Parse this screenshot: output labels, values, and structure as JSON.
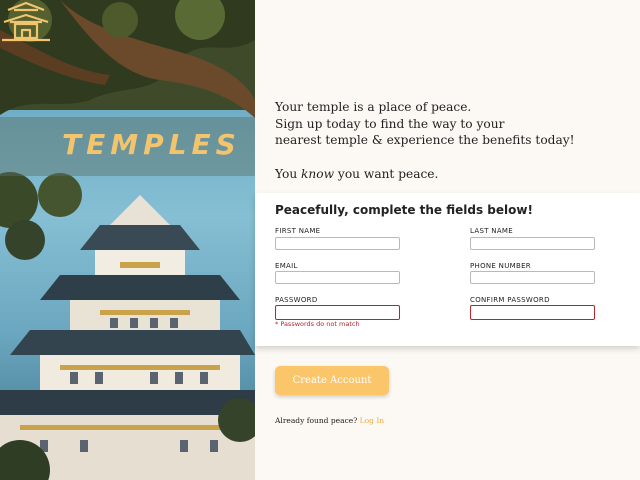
{
  "brand": {
    "name": "TEMPLES",
    "icon": "pagoda-icon",
    "color": "#f3c46e"
  },
  "intro": {
    "line1": "Your temple is a place of peace.",
    "line2": "Sign up today to find the way to your",
    "line3": "nearest temple & experience the benefits today!",
    "line4_pre": "You ",
    "line4_em": "know",
    "line4_post": " you want peace."
  },
  "form": {
    "title": "Peacefully, complete the fields below!",
    "fields": {
      "first_name": {
        "label": "FIRST NAME",
        "value": ""
      },
      "last_name": {
        "label": "LAST NAME",
        "value": ""
      },
      "email": {
        "label": "EMAIL",
        "value": ""
      },
      "phone": {
        "label": "PHONE NUMBER",
        "value": ""
      },
      "password": {
        "label": "PASSWORD",
        "value": ""
      },
      "confirm_password": {
        "label": "CONFIRM PASSWORD",
        "value": ""
      }
    },
    "error": "* Passwords do not match",
    "error_color": "#b3262f"
  },
  "actions": {
    "create_label": "Create Account",
    "button_color": "#fbc66a",
    "login_prompt": "Already found peace?",
    "login_link": "Log In",
    "link_color": "#f0a93a"
  }
}
